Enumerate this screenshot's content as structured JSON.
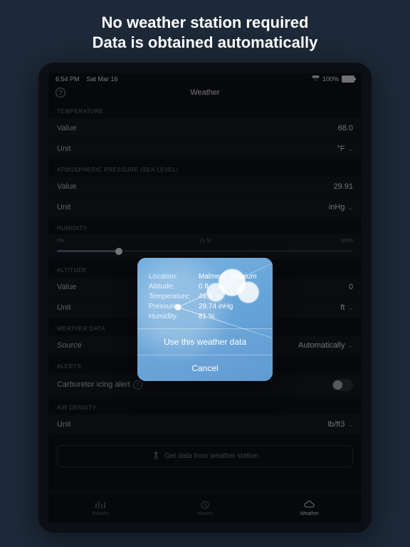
{
  "promo": {
    "line1": "No weather station required",
    "line2": "Data is obtained automatically"
  },
  "status": {
    "time": "6:54 PM",
    "date": "Sat Mar 16",
    "battery": "100%"
  },
  "nav": {
    "title": "Weather"
  },
  "temperature": {
    "header": "TEMPERATURE",
    "value_label": "Value",
    "value": "68.0",
    "unit_label": "Unit",
    "unit": "°F"
  },
  "pressure": {
    "header": "ATMOSPHERIC PRESSURE (SEA LEVEL)",
    "value_label": "Value",
    "value": "29.91",
    "unit_label": "Unit",
    "unit": "inHg"
  },
  "humidity": {
    "header": "HUMIDITY",
    "min": "0%",
    "mid": "21 %",
    "max": "100%"
  },
  "altitude": {
    "header": "ALTITUDE",
    "value_label": "Value",
    "value": "0",
    "unit_label": "Unit",
    "unit": "ft"
  },
  "weatherData": {
    "header": "WEATHER DATA",
    "source_label": "Source",
    "source": "Automatically"
  },
  "alerts": {
    "header": "ALERTS",
    "label": "Carburetor icing alert"
  },
  "airDensity": {
    "header": "AIR DENSITY",
    "unit_label": "Unit",
    "unit": "lb/ft3"
  },
  "getData": {
    "label": "Get data from weather station"
  },
  "tabs": {
    "results": "Results",
    "history": "History",
    "weather": "Weather"
  },
  "modal": {
    "rows": {
      "location_k": "Location:",
      "location_v": "Malmedy, Belgium",
      "altitude_k": "Altitude:",
      "altitude_v": "0 ft",
      "temperature_k": "Temperature:",
      "temperature_v": "49.6 °F",
      "pressure_k": "Pressure:",
      "pressure_v": "29.74 inHg",
      "humidity_k": "Humidity:",
      "humidity_v": "81 %"
    },
    "use": "Use this weather data",
    "cancel": "Cancel"
  }
}
